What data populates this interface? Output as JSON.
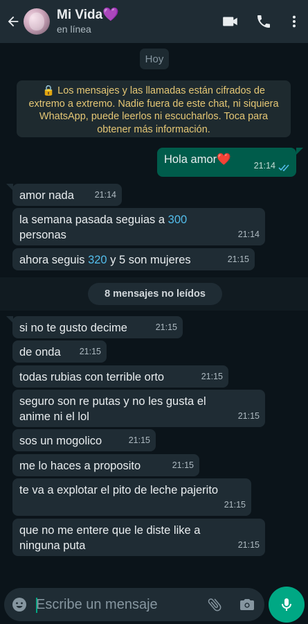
{
  "header": {
    "contact_name": "Mi Vida💜",
    "status": "en línea"
  },
  "chat": {
    "date_chip": "Hoy",
    "encryption_notice": "🔒 Los mensajes y las llamadas están cifrados de extremo a extremo. Nadie fuera de este chat, ni siquiera WhatsApp, puede leerlos ni escucharlos. Toca para obtener más información.",
    "outgoing": [
      {
        "text": "Hola amor❤️",
        "time": "21:14",
        "status": "read"
      }
    ],
    "incoming_before": [
      {
        "text": "amor nada",
        "time": "21:14"
      },
      {
        "text_a": "la semana pasada seguias a ",
        "num": "300",
        "text_b": " personas",
        "time": "21:14"
      },
      {
        "text_a": "ahora seguis ",
        "num": "320",
        "text_b": " y 5 son mujeres",
        "time": "21:15"
      }
    ],
    "unread_banner": "8 mensajes no leídos",
    "incoming_after": [
      {
        "text": "si no te gusto decime",
        "time": "21:15"
      },
      {
        "text": "de onda",
        "time": "21:15"
      },
      {
        "text": "todas rubias con terrible orto",
        "time": "21:15"
      },
      {
        "text_a": "seguro son re putas y no les gusta el",
        "text_b": "anime ni el lol",
        "time": "21:15"
      },
      {
        "text": "sos un mogolico",
        "time": "21:15"
      },
      {
        "text": "me lo haces a proposito",
        "time": "21:15"
      },
      {
        "text": "te va a explotar el pito de leche pajerito",
        "time": "21:15"
      },
      {
        "text_a": "que no me entere que le diste like a",
        "text_b": "ninguna puta",
        "time": "21:15"
      }
    ]
  },
  "composer": {
    "placeholder": "Escribe un mensaje",
    "icons": [
      "emoji-icon",
      "attach-icon",
      "camera-icon",
      "mic-icon"
    ]
  },
  "colors": {
    "header_bg": "#1f2c34",
    "chat_bg": "#0b141a",
    "incoming_bubble": "#1f2c34",
    "outgoing_bubble": "#005c4b",
    "accent": "#00a884",
    "link_number": "#53bdeb",
    "notice_text": "#e5c775"
  }
}
